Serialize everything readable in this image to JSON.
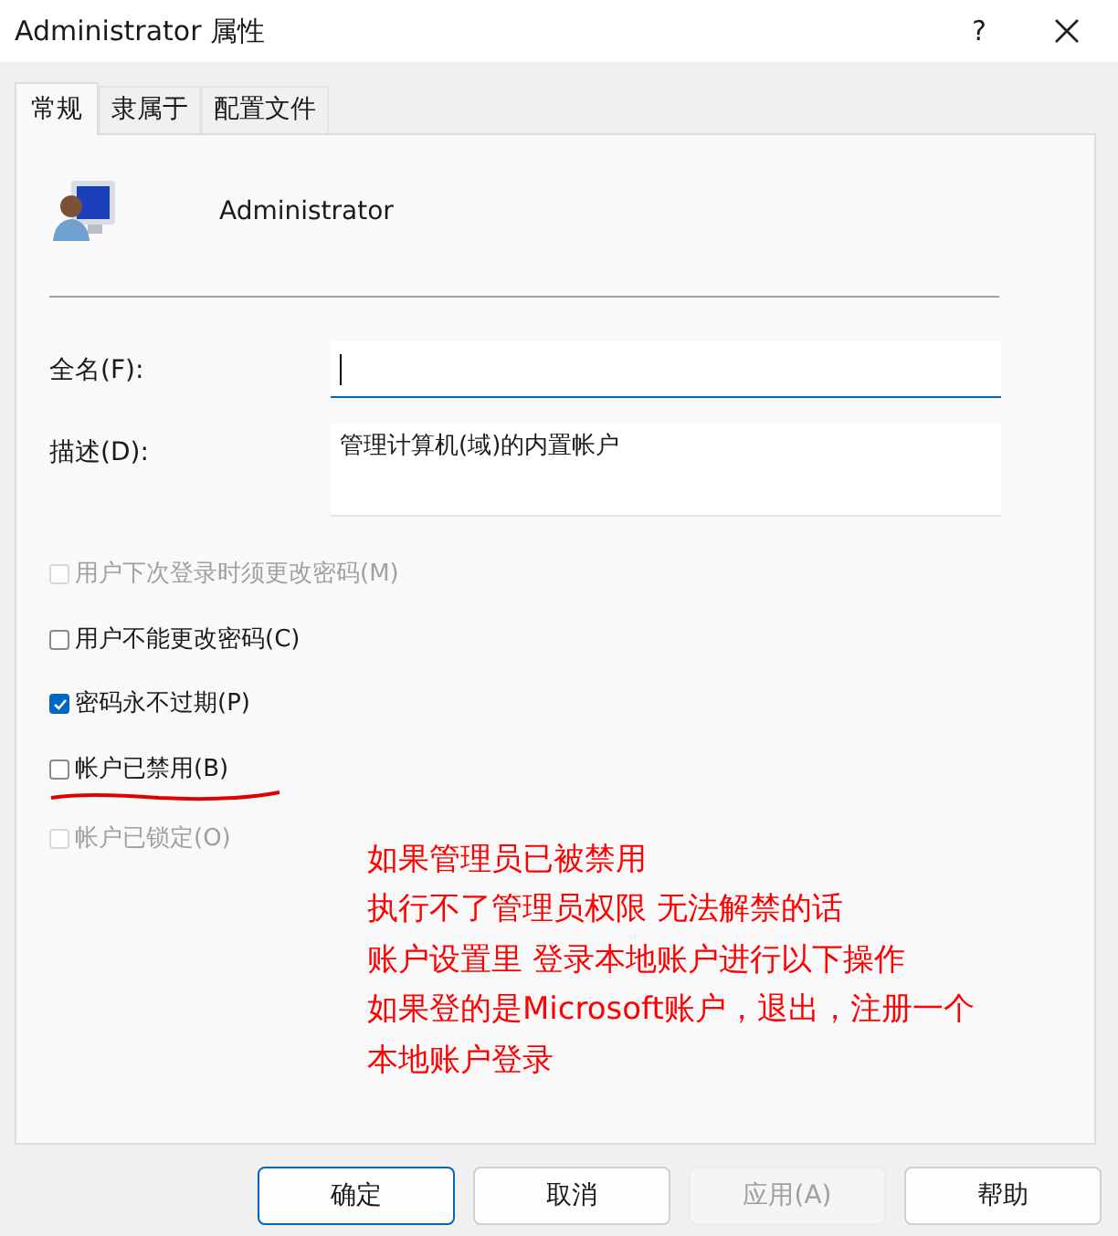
{
  "window": {
    "title": "Administrator 属性",
    "help": "?"
  },
  "tabs": [
    {
      "label": "常规",
      "selected": true
    },
    {
      "label": "隶属于",
      "selected": false
    },
    {
      "label": "配置文件",
      "selected": false
    }
  ],
  "user": {
    "name": "Administrator"
  },
  "fields": [
    {
      "label": "全名(F):",
      "focused": true,
      "kind": "line"
    },
    {
      "label": "描述(D):",
      "value": "管理计算机(域)的内置帐户",
      "focused": false,
      "kind": "multiline"
    }
  ],
  "options": [
    {
      "label": "用户下次登录时须更改密码(M)",
      "checked": false,
      "disabled": true,
      "underlined": false
    },
    {
      "label": "用户不能更改密码(C)",
      "checked": false,
      "disabled": false,
      "underlined": false
    },
    {
      "label": "密码永不过期(P)",
      "checked": true,
      "disabled": false,
      "underlined": false
    },
    {
      "label": "帐户已禁用(B)",
      "checked": false,
      "disabled": false,
      "underlined": true
    },
    {
      "label": "帐户已锁定(O)",
      "checked": false,
      "disabled": true,
      "underlined": false
    }
  ],
  "annotation": [
    "如果管理员已被禁用",
    "执行不了管理员权限 无法解禁的话",
    "账户设置里 登录本地账户进行以下操作",
    "如果登的是Microsoft账户，退出，注册一个",
    "本地账户登录"
  ],
  "buttons": [
    {
      "label": "确定",
      "disabled": false,
      "default": true
    },
    {
      "label": "取消",
      "disabled": false,
      "default": false
    },
    {
      "label": "应用(A)",
      "disabled": true,
      "default": false
    },
    {
      "label": "帮助",
      "disabled": false,
      "default": false
    }
  ]
}
